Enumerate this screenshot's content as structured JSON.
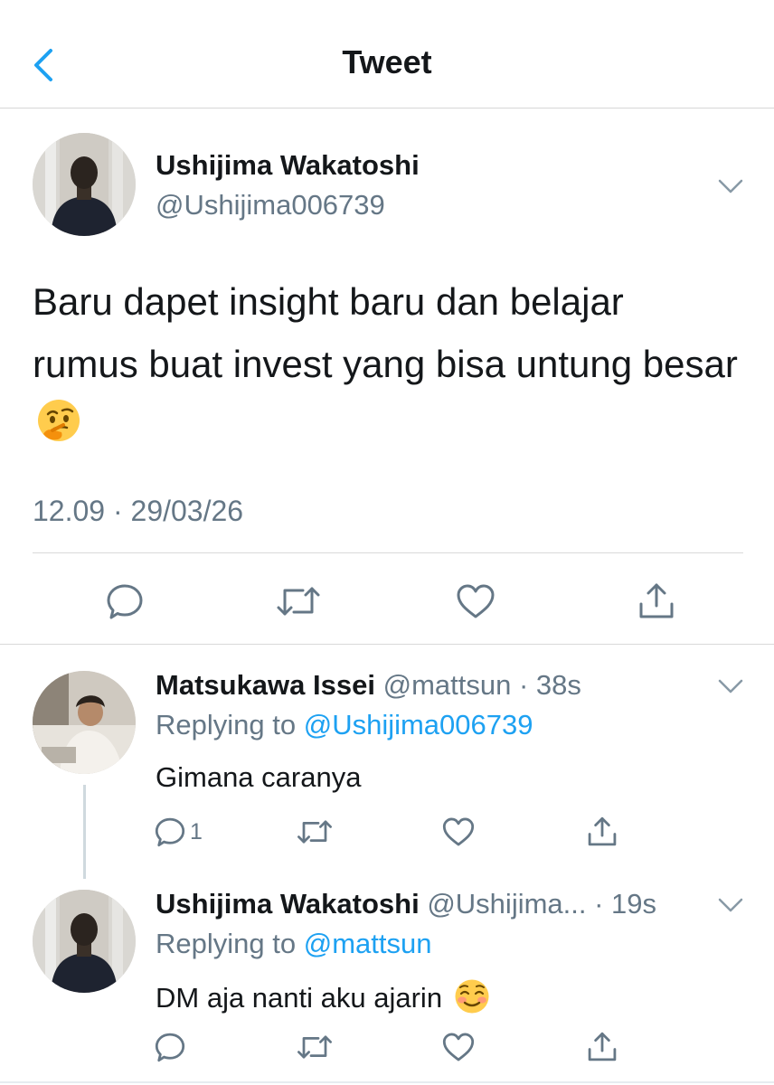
{
  "nav": {
    "title": "Tweet",
    "back_icon": "chevron-left-icon",
    "accent": "#1da1f2"
  },
  "main_tweet": {
    "name": "Ushijima Wakatoshi",
    "handle": "@Ushijima006739",
    "text": "Baru dapet insight baru dan belajar rumus buat invest yang bisa untung besar",
    "emoji": "thinking-face-emoji",
    "timestamp": "12.09 · 29/03/26",
    "actions": [
      "reply-icon",
      "retweet-icon",
      "like-icon",
      "share-icon"
    ]
  },
  "replies": [
    {
      "name": "Matsukawa Issei",
      "meta": "@mattsun · 38s",
      "replying_prefix": "Replying to ",
      "replying_to": "@Ushijima006739",
      "text": "Gimana caranya",
      "reply_count": "1"
    },
    {
      "name": "Ushijima Wakatoshi",
      "meta": "@Ushijima... · 19s",
      "replying_prefix": "Replying to ",
      "replying_to": "@mattsun",
      "text": "DM aja nanti aku ajarin",
      "emoji": "smiling-face-emoji"
    }
  ],
  "colors": {
    "text": "#14171a",
    "secondary": "#657786",
    "link": "#1da1f2",
    "icon": "#657786",
    "divider": "#d9d9d9"
  }
}
